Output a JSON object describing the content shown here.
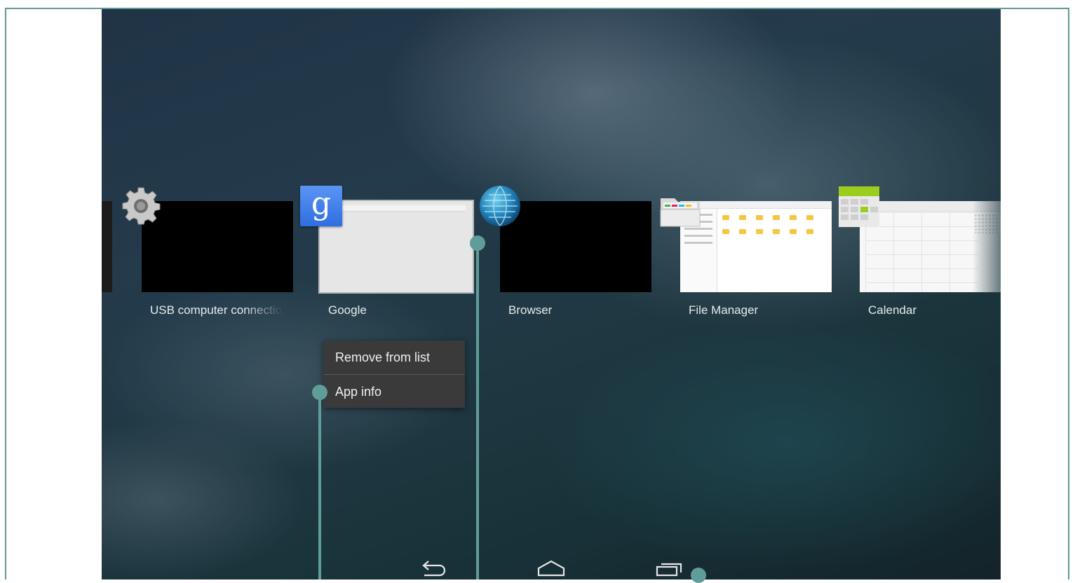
{
  "recents": [
    {
      "label": "USB computer connection",
      "icon": "settings-gear-icon"
    },
    {
      "label": "Google",
      "icon": "google-search-icon",
      "icon_letter": "g"
    },
    {
      "label": "Browser",
      "icon": "browser-globe-icon"
    },
    {
      "label": "File Manager",
      "icon": "file-manager-folder-icon"
    },
    {
      "label": "Calendar",
      "icon": "calendar-icon"
    }
  ],
  "context_menu": {
    "items": [
      "Remove from list",
      "App info"
    ]
  },
  "navbar": {
    "back": "back-icon",
    "home": "home-icon",
    "recents": "recent-apps-icon"
  },
  "colors": {
    "marker": "#5f9e98",
    "menu_bg": "#3a3a3a",
    "google_blue": "#3b78e7",
    "calendar_green": "#9ccc1e",
    "folder_yellow": "#f6c642"
  }
}
